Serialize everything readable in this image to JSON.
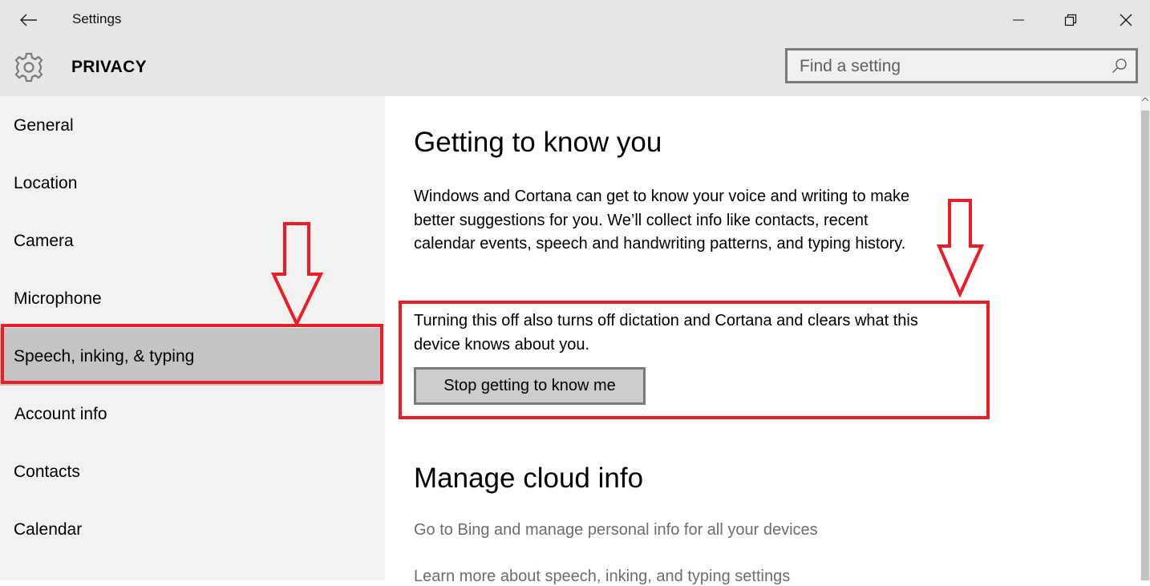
{
  "window": {
    "title": "Settings",
    "controls": {
      "minimize": "minimize",
      "restore": "restore",
      "close": "close"
    }
  },
  "header": {
    "title": "PRIVACY",
    "search": {
      "placeholder": "Find a setting",
      "value": ""
    }
  },
  "sidebar": {
    "items": [
      {
        "label": "General",
        "selected": false
      },
      {
        "label": "Location",
        "selected": false
      },
      {
        "label": "Camera",
        "selected": false
      },
      {
        "label": "Microphone",
        "selected": false
      },
      {
        "label": "Speech, inking, & typing",
        "selected": true
      },
      {
        "label": "Account info",
        "selected": false
      },
      {
        "label": "Contacts",
        "selected": false
      },
      {
        "label": "Calendar",
        "selected": false
      }
    ]
  },
  "main": {
    "section1": {
      "heading": "Getting to know you",
      "description": "Windows and Cortana can get to know your voice and writing to make better suggestions for you. We’ll collect info like contacts, recent calendar events, speech and handwriting patterns, and typing history.",
      "warning": "Turning this off also turns off dictation and Cortana and clears what this device knows about you.",
      "button_label": "Stop getting to know me"
    },
    "section2": {
      "heading": "Manage cloud info",
      "links": [
        "Go to Bing and manage personal info for all your devices",
        "Learn more about speech, inking, and typing settings"
      ]
    }
  },
  "annotations": {
    "color": "#ed1c24"
  }
}
